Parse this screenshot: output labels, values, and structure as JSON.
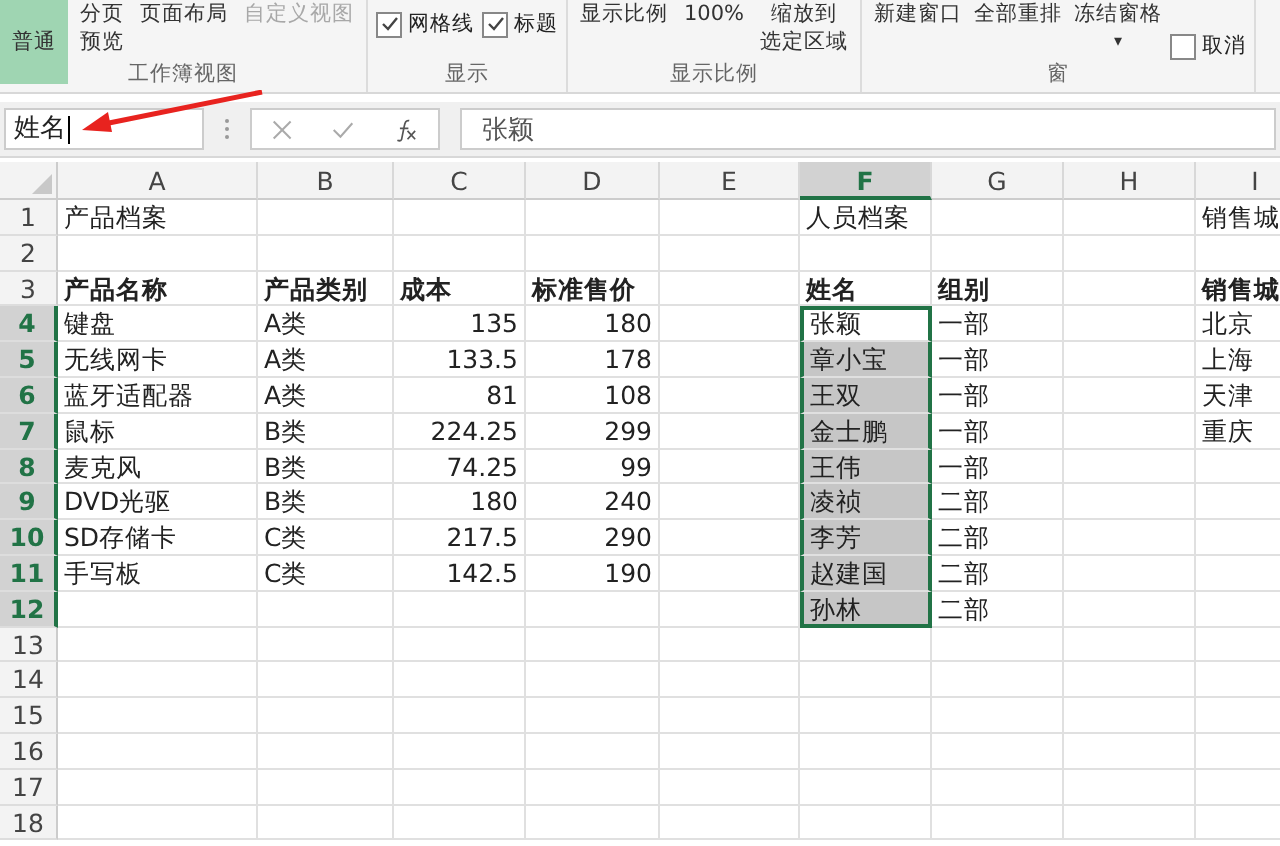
{
  "ribbon": {
    "groups": [
      {
        "label": "工作簿视图",
        "items": [
          {
            "kind": "big",
            "label": "普通",
            "selected": true,
            "disabled": false
          },
          {
            "kind": "stack",
            "lines": [
              "分页",
              "预览"
            ],
            "selected": false,
            "disabled": false
          },
          {
            "kind": "text",
            "label": "页面布局",
            "selected": false,
            "disabled": false
          },
          {
            "kind": "text",
            "label": "自定义视图",
            "selected": false,
            "disabled": true
          }
        ]
      },
      {
        "label": "显示",
        "items": [
          {
            "kind": "check",
            "label": "网格线",
            "checked": true
          },
          {
            "kind": "check",
            "label": "标题",
            "checked": true
          }
        ]
      },
      {
        "label": "显示比例",
        "items": [
          {
            "kind": "text",
            "label": "显示比例",
            "selected": false,
            "disabled": false
          },
          {
            "kind": "text",
            "label": "100%",
            "selected": false,
            "disabled": false
          },
          {
            "kind": "stack",
            "lines": [
              "缩放到",
              "选定区域"
            ],
            "selected": false,
            "disabled": false
          }
        ]
      },
      {
        "label": "窗",
        "items": [
          {
            "kind": "text",
            "label": "新建窗口",
            "selected": false,
            "disabled": false
          },
          {
            "kind": "text",
            "label": "全部重排",
            "selected": false,
            "disabled": false
          },
          {
            "kind": "dropdown",
            "label": "冻结窗格",
            "caret": "▾"
          },
          {
            "kind": "check",
            "label": "取消",
            "checked": false
          }
        ]
      }
    ]
  },
  "formula_bar": {
    "name_box": "姓名",
    "content": "张颖"
  },
  "columns": [
    {
      "letter": "A",
      "kind": "text",
      "selected": false
    },
    {
      "letter": "B",
      "kind": "text",
      "selected": false
    },
    {
      "letter": "C",
      "kind": "number",
      "selected": false
    },
    {
      "letter": "D",
      "kind": "number",
      "selected": false
    },
    {
      "letter": "E",
      "kind": "text",
      "selected": false
    },
    {
      "letter": "F",
      "kind": "text",
      "selected": true
    },
    {
      "letter": "G",
      "kind": "text",
      "selected": false
    },
    {
      "letter": "H",
      "kind": "text",
      "selected": false
    },
    {
      "letter": "I",
      "kind": "text",
      "selected": false
    }
  ],
  "rows": [
    {
      "number": "1",
      "kind": "title",
      "selected": false,
      "active": false,
      "cells": [
        "产品档案",
        null,
        null,
        null,
        null,
        "人员档案",
        null,
        null,
        "销售城"
      ]
    },
    {
      "number": "2",
      "kind": "data",
      "selected": false,
      "active": false
    },
    {
      "number": "3",
      "kind": "header",
      "selected": false,
      "active": false,
      "cells": [
        "产品名称",
        "产品类别",
        "成本",
        "标准售价",
        null,
        "姓名",
        "组别",
        null,
        "销售城"
      ]
    },
    {
      "number": "4",
      "kind": "data",
      "selected": true,
      "active": true,
      "cells": [
        "键盘",
        "A类",
        "135",
        "180",
        null,
        "张颖",
        "一部",
        null,
        "北京"
      ]
    },
    {
      "number": "5",
      "kind": "data",
      "selected": true,
      "active": false,
      "cells": [
        "无线网卡",
        "A类",
        "133.5",
        "178",
        null,
        "章小宝",
        "一部",
        null,
        "上海"
      ]
    },
    {
      "number": "6",
      "kind": "data",
      "selected": true,
      "active": false,
      "cells": [
        "蓝牙适配器",
        "A类",
        "81",
        "108",
        null,
        "王双",
        "一部",
        null,
        "天津"
      ]
    },
    {
      "number": "7",
      "kind": "data",
      "selected": true,
      "active": false,
      "cells": [
        "鼠标",
        "B类",
        "224.25",
        "299",
        null,
        "金士鹏",
        "一部",
        null,
        "重庆"
      ]
    },
    {
      "number": "8",
      "kind": "data",
      "selected": true,
      "active": false,
      "cells": [
        "麦克风",
        "B类",
        "74.25",
        "99",
        null,
        "王伟",
        "一部",
        null,
        null
      ]
    },
    {
      "number": "9",
      "kind": "data",
      "selected": true,
      "active": false,
      "cells": [
        "DVD光驱",
        "B类",
        "180",
        "240",
        null,
        "凌祯",
        "二部",
        null,
        null
      ]
    },
    {
      "number": "10",
      "kind": "data",
      "selected": true,
      "active": false,
      "cells": [
        "SD存储卡",
        "C类",
        "217.5",
        "290",
        null,
        "李芳",
        "二部",
        null,
        null
      ]
    },
    {
      "number": "11",
      "kind": "data",
      "selected": true,
      "active": false,
      "cells": [
        "手写板",
        "C类",
        "142.5",
        "190",
        null,
        "赵建国",
        "二部",
        null,
        null
      ]
    },
    {
      "number": "12",
      "kind": "data",
      "selected": true,
      "active": false,
      "cells": [
        null,
        null,
        null,
        null,
        null,
        "孙林",
        "二部",
        null,
        null
      ]
    },
    {
      "number": "13",
      "kind": "data",
      "selected": false,
      "active": false
    },
    {
      "number": "14",
      "kind": "data",
      "selected": false,
      "active": false
    },
    {
      "number": "15",
      "kind": "data",
      "selected": false,
      "active": false
    },
    {
      "number": "16",
      "kind": "data",
      "selected": false,
      "active": false
    },
    {
      "number": "17",
      "kind": "data",
      "selected": false,
      "active": false
    },
    {
      "number": "18",
      "kind": "data",
      "selected": false,
      "active": false
    }
  ]
}
